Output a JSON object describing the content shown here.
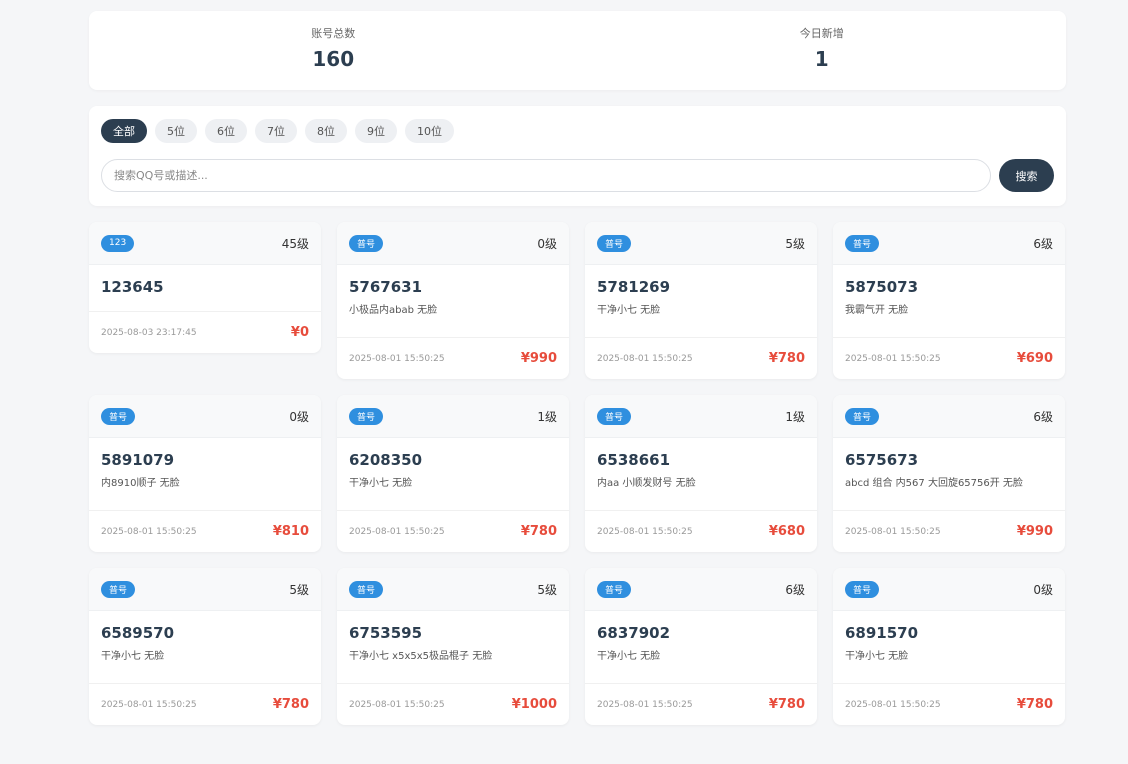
{
  "stats": {
    "total_label": "账号总数",
    "total_value": "160",
    "today_label": "今日新增",
    "today_value": "1"
  },
  "filters": [
    "全部",
    "5位",
    "6位",
    "7位",
    "8位",
    "9位",
    "10位"
  ],
  "active_filter": "全部",
  "search": {
    "placeholder": "搜索QQ号或描述...",
    "button_label": "搜索"
  },
  "cards": [
    {
      "badge": "123",
      "level": "45级",
      "qq": "123645",
      "desc": "",
      "date": "2025-08-03 23:17:45",
      "price": "¥0"
    },
    {
      "badge": "普号",
      "level": "0级",
      "qq": "5767631",
      "desc": "小极品内abab 无脸",
      "date": "2025-08-01 15:50:25",
      "price": "¥990"
    },
    {
      "badge": "普号",
      "level": "5级",
      "qq": "5781269",
      "desc": "干净小七 无脸",
      "date": "2025-08-01 15:50:25",
      "price": "¥780"
    },
    {
      "badge": "普号",
      "level": "6级",
      "qq": "5875073",
      "desc": "我霸气开 无脸",
      "date": "2025-08-01 15:50:25",
      "price": "¥690"
    },
    {
      "badge": "普号",
      "level": "0级",
      "qq": "5891079",
      "desc": "内8910顺子 无脸",
      "date": "2025-08-01 15:50:25",
      "price": "¥810"
    },
    {
      "badge": "普号",
      "level": "1级",
      "qq": "6208350",
      "desc": "干净小七 无脸",
      "date": "2025-08-01 15:50:25",
      "price": "¥780"
    },
    {
      "badge": "普号",
      "level": "1级",
      "qq": "6538661",
      "desc": "内aa 小顺发财号 无脸",
      "date": "2025-08-01 15:50:25",
      "price": "¥680"
    },
    {
      "badge": "普号",
      "level": "6级",
      "qq": "6575673",
      "desc": "abcd 组合 内567 大回旋65756开 无脸",
      "date": "2025-08-01 15:50:25",
      "price": "¥990"
    },
    {
      "badge": "普号",
      "level": "5级",
      "qq": "6589570",
      "desc": "干净小七 无脸",
      "date": "2025-08-01 15:50:25",
      "price": "¥780"
    },
    {
      "badge": "普号",
      "level": "5级",
      "qq": "6753595",
      "desc": "干净小七 x5x5x5极品棍子 无脸",
      "date": "2025-08-01 15:50:25",
      "price": "¥1000"
    },
    {
      "badge": "普号",
      "level": "6级",
      "qq": "6837902",
      "desc": "干净小七 无脸",
      "date": "2025-08-01 15:50:25",
      "price": "¥780"
    },
    {
      "badge": "普号",
      "level": "0级",
      "qq": "6891570",
      "desc": "干净小七 无脸",
      "date": "2025-08-01 15:50:25",
      "price": "¥780"
    }
  ],
  "colors": {
    "primary": "#2c3e50",
    "badge": "#2f8fdf",
    "price": "#e74c3c",
    "background": "#f5f6f8"
  }
}
